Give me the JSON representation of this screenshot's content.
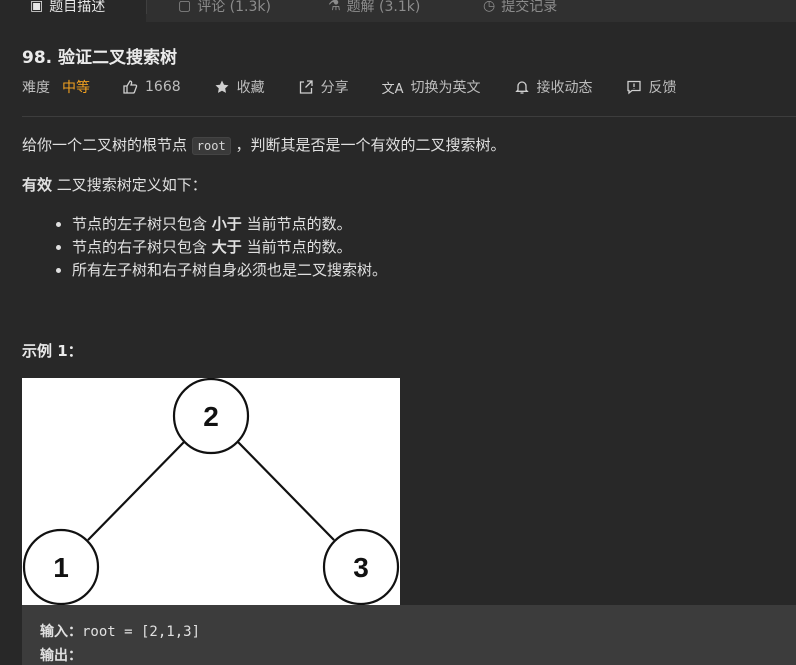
{
  "tabs": [
    {
      "label": "题目描述",
      "icon": "document-icon"
    },
    {
      "label": "评论 (1.3k)",
      "icon": "comment-icon"
    },
    {
      "label": "题解 (3.1k)",
      "icon": "flask-icon"
    },
    {
      "label": "提交记录",
      "icon": "clock-icon"
    }
  ],
  "problem": {
    "title": "98. 验证二叉搜索树",
    "difficulty_label": "难度",
    "difficulty": "中等",
    "difficulty_color": "#f0a020",
    "actions": {
      "likes": "1668",
      "favorite": "收藏",
      "share": "分享",
      "translate": "切换为英文",
      "subscribe": "接收动态",
      "feedback": "反馈"
    }
  },
  "description": {
    "p1_before": "给你一个二叉树的根节点",
    "p1_code": "root",
    "p1_after": "，判断其是否是一个有效的二叉搜索树。",
    "p2_bold": "有效",
    "p2_rest": " 二叉搜索树定义如下：",
    "rules": [
      {
        "before": "节点的左子树只包含 ",
        "bold": "小于",
        "after": " 当前节点的数。"
      },
      {
        "before": "节点的右子树只包含 ",
        "bold": "大于",
        "after": " 当前节点的数。"
      },
      {
        "before": "所有左子树和右子树自身必须也是二叉搜索树。",
        "bold": "",
        "after": ""
      }
    ]
  },
  "example": {
    "title": "示例 1：",
    "tree_nodes": [
      "2",
      "1",
      "3"
    ],
    "input_label": "输入：",
    "input_value": "root = [2,1,3]",
    "output_label": "输出："
  }
}
